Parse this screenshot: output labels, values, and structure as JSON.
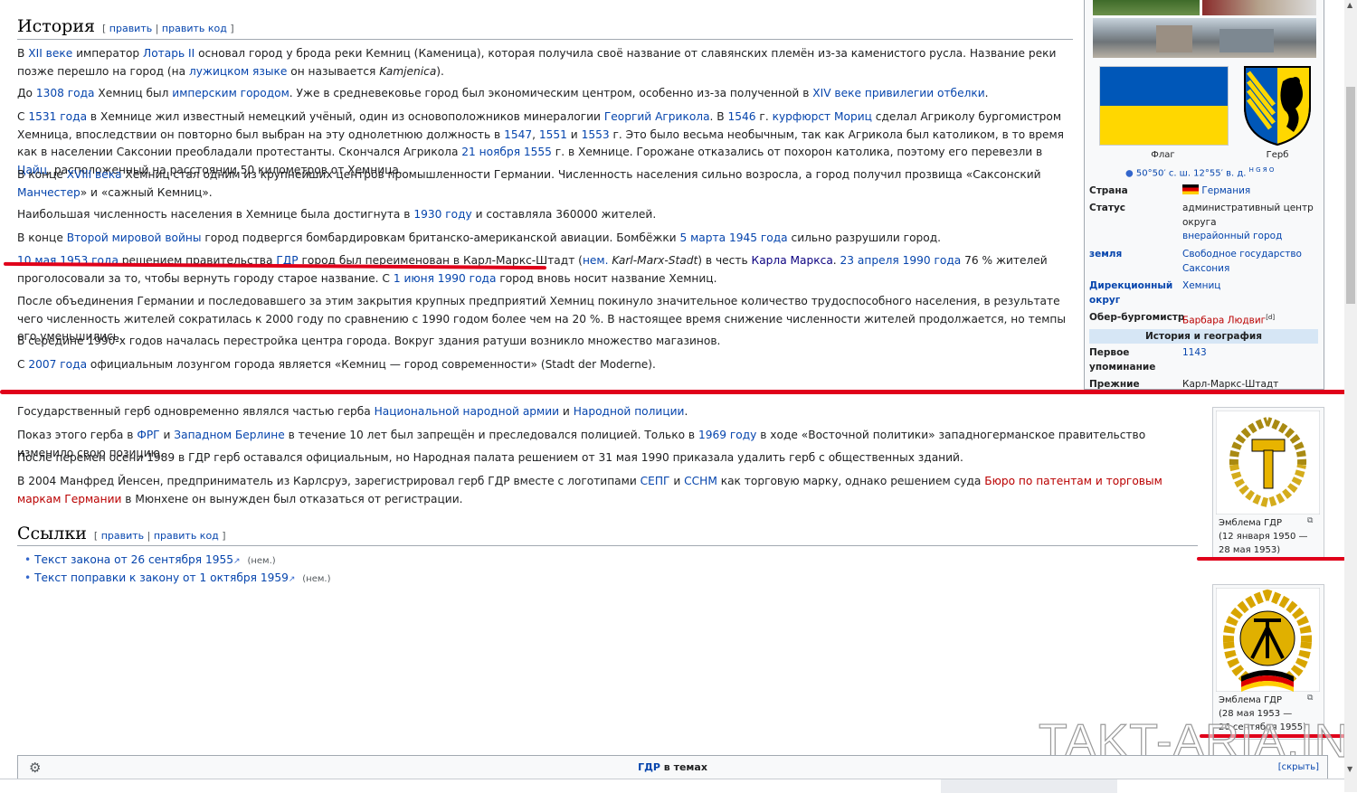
{
  "history": {
    "heading": "История",
    "edit": "править",
    "edit_code": "править код",
    "p1": {
      "t1": "В ",
      "l1": "XII веке",
      "t2": " император ",
      "l2": "Лотарь II",
      "t3": " основал город у брода реки Кемниц (Каменица), которая получила своё название от славянских племён из-за каменистого русла. Название реки позже перешло на город (на ",
      "l3": "лужицком языке",
      "t4": " он называется ",
      "t5": "Kamjenica",
      "t6": ")."
    },
    "p2": {
      "t1": "До ",
      "l1": "1308 года",
      "t2": " Хемниц был ",
      "l2": "имперским городом",
      "t3": ". Уже в средневековье город был экономическим центром, особенно из-за полученной в ",
      "l3": "XIV веке",
      "t4": " ",
      "l4": "привилегии отбелки",
      "t5": "."
    },
    "p3": {
      "t1": "С ",
      "l1": "1531 года",
      "t2": " в Хемнице жил известный немецкий учёный, один из основоположников минералогии ",
      "l2": "Георгий Агрикола",
      "t3": ". В ",
      "l3": "1546",
      "t4": " г. ",
      "l4": "курфюрст Мориц",
      "t5": " сделал Агриколу бургомистром Хемница, впоследствии он повторно был выбран на эту однолетнюю должность в ",
      "l5": "1547",
      "t6": ", ",
      "l6": "1551",
      "t7": " и ",
      "l7": "1553",
      "t8": " г. Это было весьма необычным, так как Агрикола был католиком, в то время как в населении Саксонии преобладали протестанты. Скончался Агрикола ",
      "l8": "21 ноября",
      "t9": " ",
      "l9": "1555",
      "t10": " г. в Хемнице. Горожане отказались от похорон католика, поэтому его перевезли в ",
      "l10": "Цайц",
      "t11": ", расположенный на расстоянии 50 километров от Хемница."
    },
    "p4": {
      "t1": "В конце ",
      "l1": "XVIII века",
      "t2": " Хемниц стал одним из крупнейших центров промышленности Германии. Численность населения сильно возросла, а город получил прозвища «Саксонский ",
      "l2": "Манчестер",
      "t3": "» и «сажный Кемниц»."
    },
    "p5": {
      "t1": "Наибольшая численность населения в Хемнице была достигнута в ",
      "l1": "1930 году",
      "t2": " и составляла 360000 жителей."
    },
    "p6": {
      "t1": "В конце ",
      "l1": "Второй мировой войны",
      "t2": " город подвергся бомбардировкам британско-американской авиации. Бомбёжки ",
      "l2": "5 марта",
      "t3": " ",
      "l3": "1945 года",
      "t4": " сильно разрушили город."
    },
    "p7": {
      "l1": "10 мая",
      "t1": " ",
      "l2": "1953 года",
      "t2": " решением правительства ",
      "l3": "ГДР",
      "t3": " город был переименован в Карл-Маркс-Штадт (",
      "l4": "нем.",
      "t4": " ",
      "t5": "Karl-Marx-Stadt",
      "t6": ") в честь ",
      "l5": "Карла Маркса",
      "t7": ". ",
      "l6": "23 апреля",
      "t8": " ",
      "l7": "1990 года",
      "t9": " 76 % жителей проголосовали за то, чтобы вернуть городу старое название. С ",
      "l8": "1 июня",
      "t10": " ",
      "l9": "1990 года",
      "t11": " город вновь носит название Хемниц."
    },
    "p8": "После объединения Германии и последовавшего за этим закрытия крупных предприятий Хемниц покинуло значительное количество трудоспособного населения, в результате чего численность жителей сократилась к 2000 году по сравнению с 1990 годом более чем на 20 %. В настоящее время снижение численности жителей продолжается, но темпы его уменьшились.",
    "p9": "В середине 1990-х годов началась перестройка центра города. Вокруг здания ратуши возникло множество магазинов.",
    "p10": {
      "t1": "С ",
      "l1": "2007 года",
      "t2": " официальным лозунгом города является «Кемниц — город современности» (Stadt der Moderne)."
    }
  },
  "infobox": {
    "flag_caption": "Флаг",
    "coa_caption": "Герб",
    "coords": "50°50′ с. ш. 12°55′ в. д.",
    "coords_links": "H G Я O",
    "rows": [
      {
        "label": "Страна",
        "value": "Германия"
      },
      {
        "label": "Статус",
        "value": "административный центр округа",
        "value2": "внерайонный город"
      },
      {
        "label": "земля",
        "value": "Свободное государство Саксония"
      },
      {
        "label1": "Дирекционный",
        "label2": "округ",
        "value": "Хемниц"
      },
      {
        "label": "Обер-бургомистр",
        "value": "Барбара Людвиг",
        "sup": "[d]"
      }
    ],
    "section": "История и география",
    "first_mention_label1": "Первое",
    "first_mention_label2": "упоминание",
    "first_mention_value": "1143",
    "former_label": "Прежние",
    "former_value": "Карл-Маркс-Штадт"
  },
  "gdr": {
    "p1": {
      "t1": "Государственный герб одновременно являлся частью герба ",
      "l1": "Национальной народной армии",
      "t2": " и ",
      "l2": "Народной полиции",
      "t3": "."
    },
    "p2": {
      "t1": "Показ этого герба в ",
      "l1": "ФРГ",
      "t2": " и ",
      "l2": "Западном Берлине",
      "t3": " в течение 10 лет был запрещён и преследовался полицией. Только в ",
      "l3": "1969 году",
      "t4": " в ходе «Восточной политики» западногерманское правительство изменило свою позицию."
    },
    "p3": "После перемен осени 1989 в ГДР герб оставался официальным, но Народная палата решением от 31 мая 1990 приказала удалить герб с общественных зданий.",
    "p4": {
      "t1": "В 2004 Манфред Йенсен, предприниматель из Карлсруэ, зарегистрировал герб ГДР вместе с логотипами ",
      "l1": "СЕПГ",
      "t2": " и ",
      "l2": "ССНМ",
      "t3": " как торговую марку, однако решением суда ",
      "l3": "Бюро по патентам и торговым маркам Германии",
      "t4": " в Мюнхене он вынужден был отказаться от регистрации."
    },
    "links_heading": "Ссылки",
    "link1": "Текст закона от 26 сентября 1955",
    "link2": "Текст поправки к закону от 1 октября 1959",
    "lang": "(нем.)",
    "emblem1": {
      "l1": "Эмблема ГДР",
      "l2": "(12 января 1950 —",
      "l3": "28 мая 1953)"
    },
    "emblem2": {
      "l1": "Эмблема ГДР",
      "l2": "(28 мая 1953 —",
      "l3": "26 сентября 1955)"
    }
  },
  "navbox": {
    "link": "ГДР",
    "text": " в темах",
    "hide": "[скрыть]"
  },
  "watermark": "TAKT-ARIA.INFO",
  "colors": {
    "link": "#0645ad",
    "redlink": "#ba0000",
    "annotation": "#e0001a"
  }
}
